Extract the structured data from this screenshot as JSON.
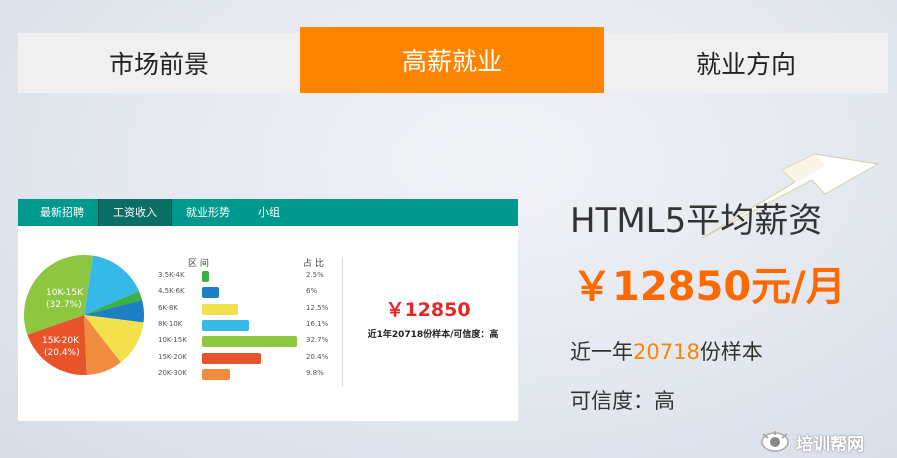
{
  "top_tabs": {
    "items": [
      {
        "label": "市场前景"
      },
      {
        "label": "高薪就业"
      },
      {
        "label": "就业方向"
      }
    ],
    "active_index": 1,
    "active_color": "#ff8400"
  },
  "card": {
    "tabs": [
      {
        "label": "最新招聘"
      },
      {
        "label": "工资收入"
      },
      {
        "label": "就业形势"
      },
      {
        "label": "小组"
      }
    ],
    "active_tab": 1,
    "header_color": "#00998d",
    "columns": {
      "range": "区 间",
      "share": "占 比"
    },
    "rows": [
      {
        "range": "3.5K-4K",
        "pct": "2.5%",
        "value": 2.5,
        "color": "#3cb043"
      },
      {
        "range": "4.5K-6K",
        "pct": "6%",
        "value": 6,
        "color": "#1f7fc4"
      },
      {
        "range": "6K-8K",
        "pct": "12.5%",
        "value": 12.5,
        "color": "#f2e14c"
      },
      {
        "range": "8K-10K",
        "pct": "16.1%",
        "value": 16.1,
        "color": "#36b8e8"
      },
      {
        "range": "10K-15K",
        "pct": "32.7%",
        "value": 32.7,
        "color": "#8dc63f"
      },
      {
        "range": "15K-20K",
        "pct": "20.4%",
        "value": 20.4,
        "color": "#e8542a"
      },
      {
        "range": "20K-30K",
        "pct": "9.8%",
        "value": 9.8,
        "color": "#f18b3f"
      }
    ],
    "pie_labels": [
      {
        "name": "10K-15K",
        "pct": "(32.7%)"
      },
      {
        "name": "15K-20K",
        "pct": "(20.4%)"
      }
    ],
    "salary": "￥12850",
    "note": "近1年20718份样本/可信度：高"
  },
  "headline": "HTML5平均薪资",
  "big_salary": "￥12850元/月",
  "samples": {
    "prefix": "近一年",
    "count": "20718",
    "suffix": "份样本"
  },
  "credibility": "可信度：高",
  "brand": "培训帮网"
}
